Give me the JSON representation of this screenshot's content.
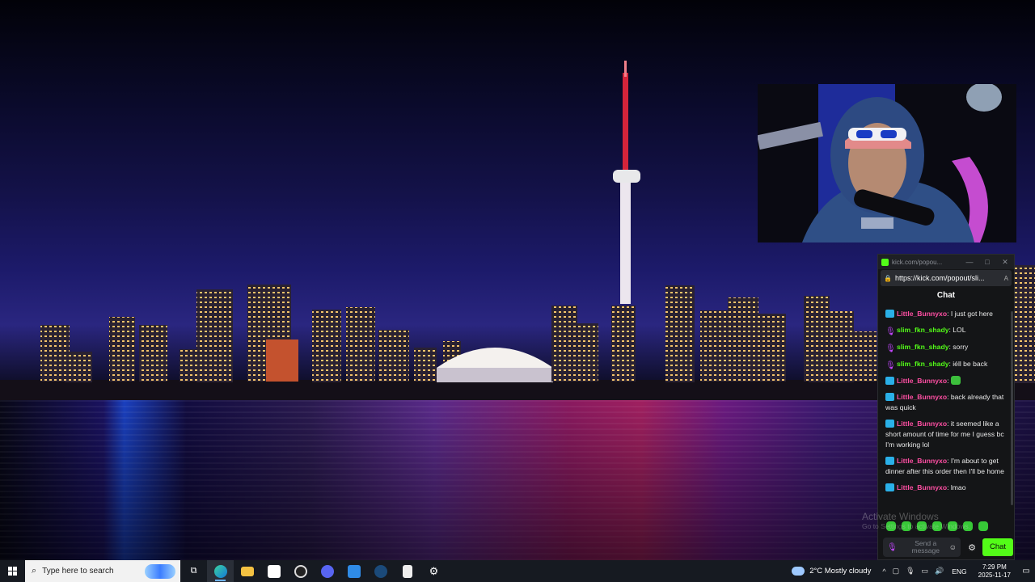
{
  "desktop": {
    "wallpaper": "Toronto skyline at night"
  },
  "chat_window": {
    "title": "kick.com/popou...",
    "window_controls": [
      "—",
      "□",
      "✕"
    ],
    "url": "https://kick.com/popout/sli...",
    "url_suffix": "A",
    "header": "Chat",
    "messages": [
      {
        "user": "Little_Bunnyxo",
        "text": ": I just got here",
        "badge": "kick-icon",
        "color": "#ff4fa3"
      },
      {
        "user": "slim_fkn_shady",
        "text": ": LOL",
        "badge": "mic-icon",
        "color": "#53fc18"
      },
      {
        "user": "slim_fkn_shady",
        "text": ": sorry",
        "badge": "mic-icon",
        "color": "#53fc18"
      },
      {
        "user": "slim_fkn_shady",
        "text": ": iéll be back",
        "badge": "mic-icon",
        "color": "#53fc18"
      },
      {
        "user": "Little_Bunnyxo",
        "text": ":",
        "badge": "kick-icon",
        "color": "#ff4fa3",
        "emote": true
      },
      {
        "user": "Little_Bunnyxo",
        "text": ": back already that was quick",
        "badge": "kick-icon",
        "color": "#ff4fa3"
      },
      {
        "user": "Little_Bunnyxo",
        "text": ": it seemed like a short amount of time for me I guess bc I'm working lol",
        "badge": "kick-icon",
        "color": "#ff4fa3"
      },
      {
        "user": "Little_Bunnyxo",
        "text": ": I'm about to get dinner after this order then I'll be home",
        "badge": "kick-icon",
        "color": "#ff4fa3"
      },
      {
        "user": "Little_Bunnyxo",
        "text": ": lmao",
        "badge": "kick-icon",
        "color": "#ff4fa3"
      }
    ],
    "input_placeholder": "Send a message",
    "send_label": "Chat"
  },
  "watermark": {
    "title": "Activate Windows",
    "subtitle": "Go to Settings to activate Windows."
  },
  "taskbar": {
    "search_placeholder": "Type here to search",
    "apps": [
      "task-view-icon",
      "edge-icon",
      "file-explorer-icon",
      "store-icon",
      "obs-icon",
      "discord-icon",
      "vscode-icon",
      "steam-icon",
      "epic-games-icon",
      "settings-icon"
    ],
    "weather": "2°C  Mostly cloudy",
    "language": "ENG",
    "time": "7:29 PM",
    "date": "2025-11-17"
  },
  "colors": {
    "accent": "#53fc18",
    "taskbar": "#161a21",
    "chat_bg": "#141517"
  }
}
